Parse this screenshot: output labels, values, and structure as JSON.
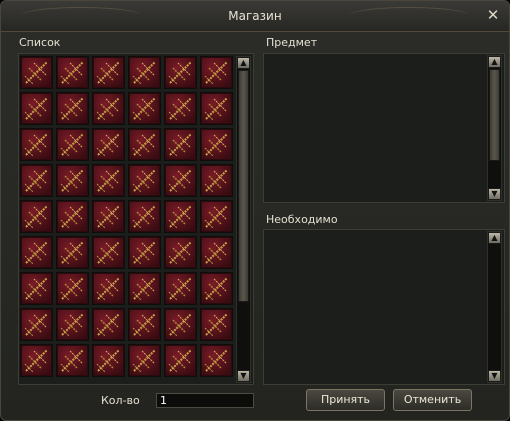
{
  "window": {
    "title": "Магазин"
  },
  "labels": {
    "list": "Список",
    "item": "Предмет",
    "required": "Необходимо",
    "quantity": "Кол-во"
  },
  "quantity_value": "1",
  "buttons": {
    "accept": "Принять",
    "cancel": "Отменить"
  },
  "grid": {
    "columns": 6,
    "rows": 9,
    "item_icon": "crossbow-icon"
  },
  "colors": {
    "cell": "#6b1822",
    "panel": "#1b1e1a",
    "frame": "#4a463d"
  },
  "scroll_icons": {
    "up": "▲",
    "down": "▼"
  }
}
